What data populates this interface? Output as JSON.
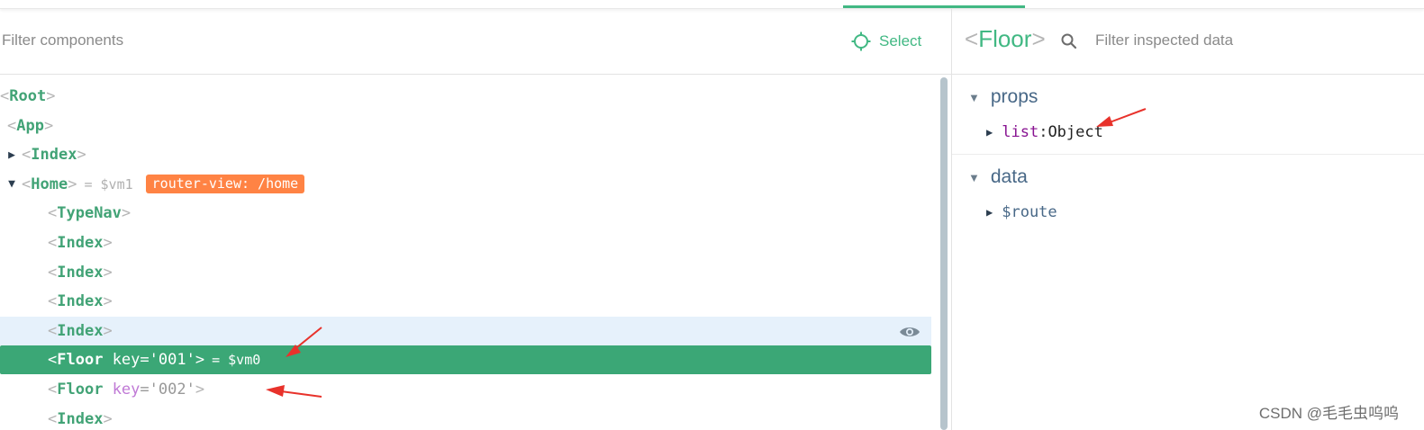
{
  "left": {
    "filter_placeholder": "Filter components",
    "select_label": "Select",
    "tree": [
      {
        "name": "Root",
        "indent": 0,
        "arrow": "",
        "state": ""
      },
      {
        "name": "App",
        "indent": 1,
        "arrow": "",
        "state": ""
      },
      {
        "name": "Index",
        "indent": 1,
        "arrow": "right",
        "state": ""
      },
      {
        "name": "Home",
        "indent": 1,
        "arrow": "down",
        "state": "",
        "vm": "= $vm1",
        "badge": "router-view: /home"
      },
      {
        "name": "TypeNav",
        "indent": 2,
        "arrow": "",
        "state": ""
      },
      {
        "name": "Index",
        "indent": 2,
        "arrow": "",
        "state": ""
      },
      {
        "name": "Index",
        "indent": 2,
        "arrow": "",
        "state": ""
      },
      {
        "name": "Index",
        "indent": 2,
        "arrow": "",
        "state": ""
      },
      {
        "name": "Index",
        "indent": 2,
        "arrow": "",
        "state": "hover"
      },
      {
        "name": "Floor",
        "indent": 2,
        "arrow": "",
        "state": "selected",
        "attr_name": "key",
        "attr_val": "'001'",
        "vm": "= $vm0"
      },
      {
        "name": "Floor",
        "indent": 2,
        "arrow": "",
        "state": "",
        "attr_name": "key",
        "attr_val": "'002'"
      },
      {
        "name": "Index",
        "indent": 2,
        "arrow": "",
        "state": ""
      }
    ]
  },
  "right": {
    "inspected_name": "Floor",
    "filter_placeholder": "Filter inspected data",
    "sections": [
      {
        "title": "props",
        "items": [
          {
            "key": "list",
            "value": "Object"
          }
        ]
      },
      {
        "title": "data",
        "items": [
          {
            "key": "$route",
            "value": ""
          }
        ]
      }
    ]
  },
  "watermark": "CSDN @毛毛虫呜呜",
  "colors": {
    "accent": "#41b883",
    "selected_row": "#3ba776",
    "hover_row": "#e6f1fb",
    "badge": "#ff8344",
    "annotation_arrow": "#e8322b"
  }
}
